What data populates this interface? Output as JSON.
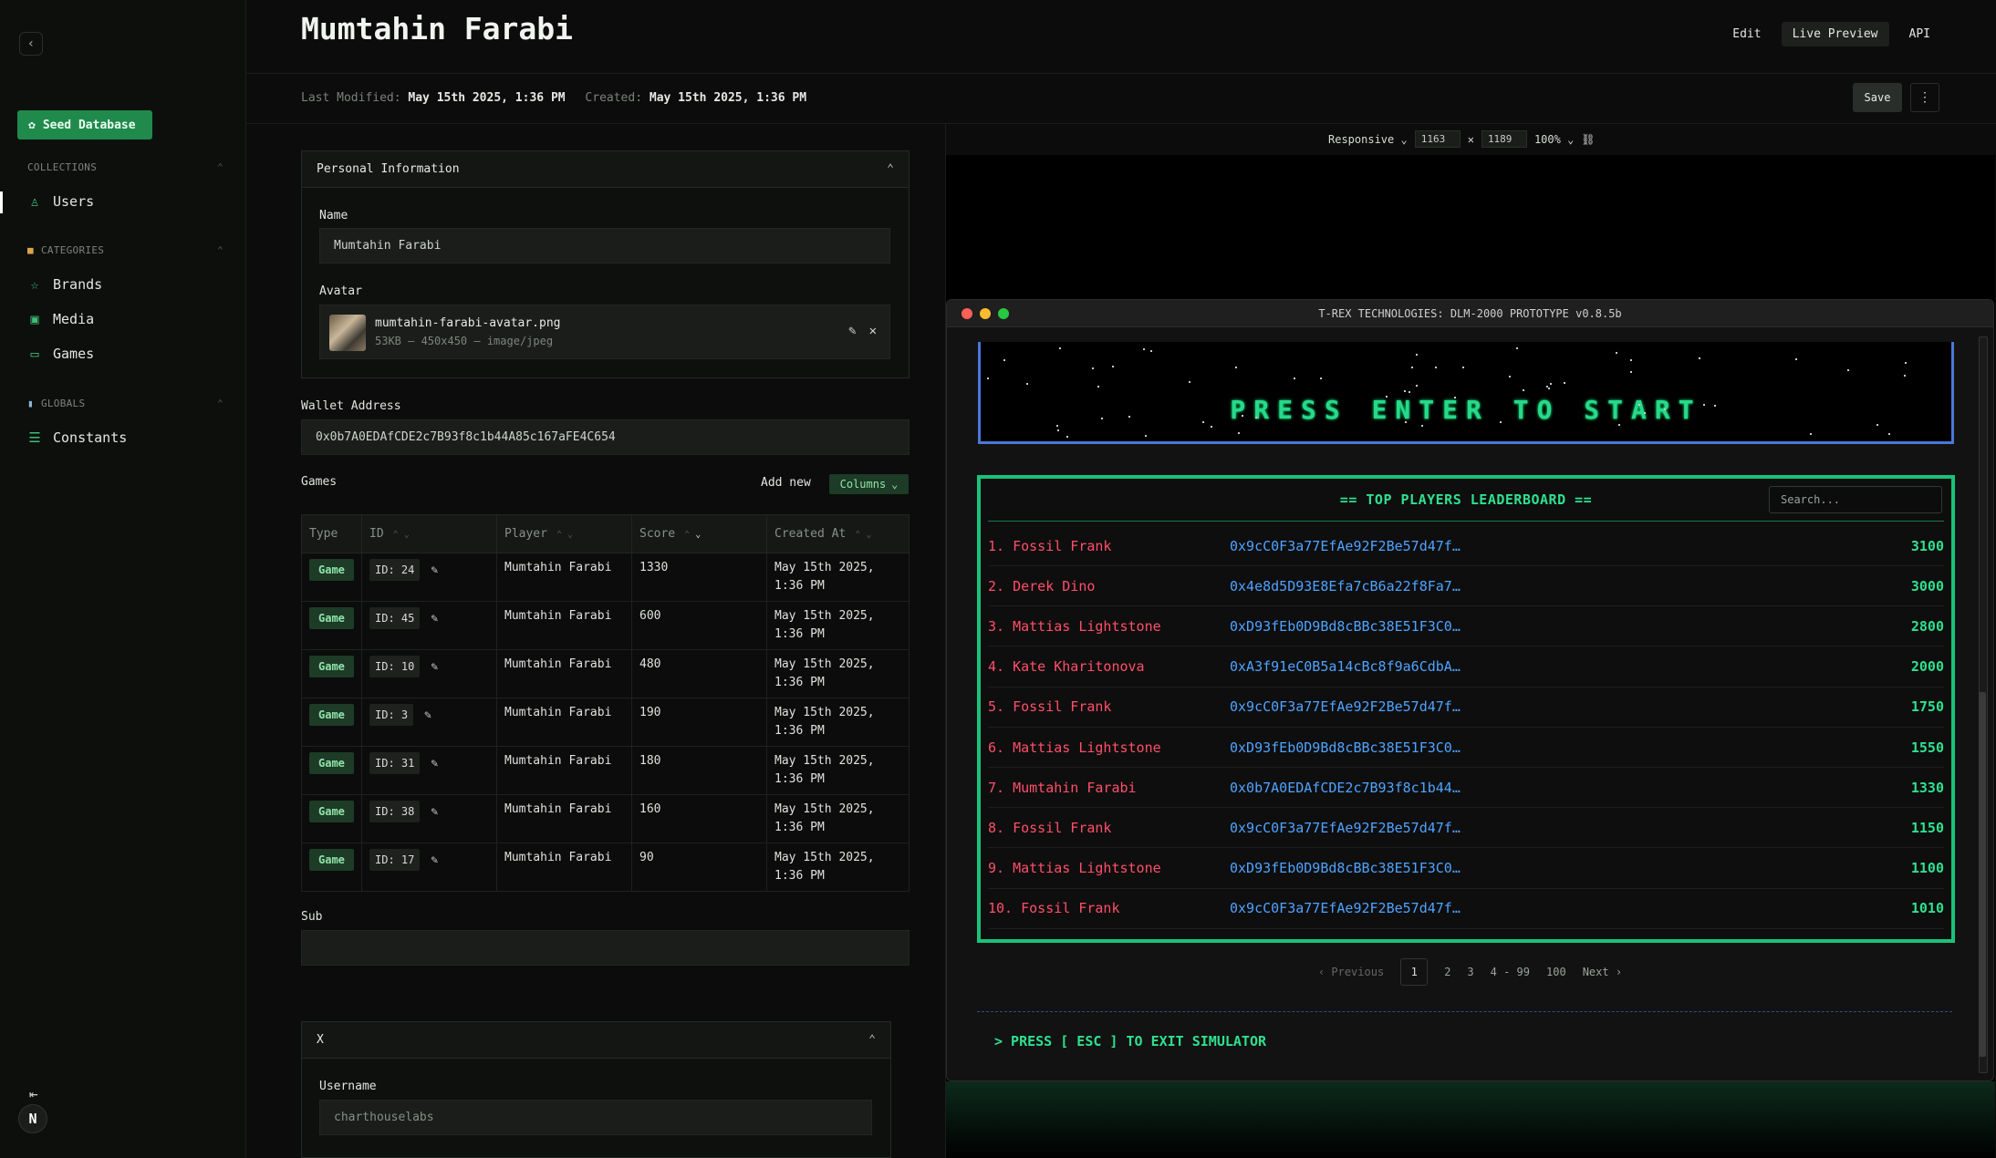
{
  "page": {
    "title": "Mumtahin Farabi"
  },
  "top_tabs": [
    "Edit",
    "Live Preview",
    "API"
  ],
  "meta": {
    "modified_label": "Last Modified:",
    "modified_value": "May 15th 2025, 1:36 PM",
    "created_label": "Created:",
    "created_value": "May 15th 2025, 1:36 PM"
  },
  "actions": {
    "save": "Save"
  },
  "sidebar": {
    "seed_button": "Seed Database",
    "collections_label": "COLLECTIONS",
    "users": "Users",
    "categories_label": "CATEGORIES",
    "brands": "Brands",
    "media": "Media",
    "games": "Games",
    "globals_label": "GLOBALS",
    "constants": "Constants",
    "avatar_letter": "N"
  },
  "form": {
    "personal_section": "Personal Information",
    "name_label": "Name",
    "name_value": "Mumtahin Farabi",
    "avatar_label": "Avatar",
    "avatar_file": "mumtahin-farabi-avatar.png",
    "avatar_meta": "53KB — 450x450 — image/jpeg",
    "wallet_label": "Wallet Address",
    "wallet_value": "0x0b7A0EDAfCDE2c7B93f8c1b44A85c167aFE4C654",
    "games_label": "Games",
    "add_new": "Add new",
    "columns": "Columns",
    "table_headers": {
      "type": "Type",
      "id": "ID",
      "player": "Player",
      "score": "Score",
      "created": "Created At"
    },
    "rows": [
      {
        "type": "Game",
        "id": "ID: 24",
        "player": "Mumtahin Farabi",
        "score": "1330",
        "date": "May 15th 2025,",
        "time": "1:36 PM"
      },
      {
        "type": "Game",
        "id": "ID: 45",
        "player": "Mumtahin Farabi",
        "score": "600",
        "date": "May 15th 2025,",
        "time": "1:36 PM"
      },
      {
        "type": "Game",
        "id": "ID: 10",
        "player": "Mumtahin Farabi",
        "score": "480",
        "date": "May 15th 2025,",
        "time": "1:36 PM"
      },
      {
        "type": "Game",
        "id": "ID: 3",
        "player": "Mumtahin Farabi",
        "score": "190",
        "date": "May 15th 2025,",
        "time": "1:36 PM"
      },
      {
        "type": "Game",
        "id": "ID: 31",
        "player": "Mumtahin Farabi",
        "score": "180",
        "date": "May 15th 2025,",
        "time": "1:36 PM"
      },
      {
        "type": "Game",
        "id": "ID: 38",
        "player": "Mumtahin Farabi",
        "score": "160",
        "date": "May 15th 2025,",
        "time": "1:36 PM"
      },
      {
        "type": "Game",
        "id": "ID: 17",
        "player": "Mumtahin Farabi",
        "score": "90",
        "date": "May 15th 2025,",
        "time": "1:36 PM"
      }
    ],
    "sub_label": "Sub",
    "x_section": "X",
    "username_label": "Username",
    "username_placeholder": "charthouselabs"
  },
  "preview": {
    "responsive": "Responsive",
    "width": "1163",
    "height": "1189",
    "zoom": "100%",
    "window_title": "T-REX TECHNOLOGIES: DLM-2000 PROTOTYPE v0.8.5b",
    "press_enter": "PRESS ENTER TO START",
    "board_title": "== TOP PLAYERS LEADERBOARD ==",
    "search_placeholder": "Search...",
    "leaderboard": [
      {
        "rank": "1.",
        "name": "Fossil Frank",
        "addr": "0x9cC0F3a77EfAe92F2Be57d47f…",
        "score": "3100"
      },
      {
        "rank": "2.",
        "name": "Derek Dino",
        "addr": "0x4e8d5D93E8Efa7cB6a22f8Fa7…",
        "score": "3000"
      },
      {
        "rank": "3.",
        "name": "Mattias Lightstone",
        "addr": "0xD93fEb0D9Bd8cBBc38E51F3C0…",
        "score": "2800"
      },
      {
        "rank": "4.",
        "name": "Kate Kharitonova",
        "addr": "0xA3f91eC0B5a14cBc8f9a6CdbA…",
        "score": "2000"
      },
      {
        "rank": "5.",
        "name": "Fossil Frank",
        "addr": "0x9cC0F3a77EfAe92F2Be57d47f…",
        "score": "1750"
      },
      {
        "rank": "6.",
        "name": "Mattias Lightstone",
        "addr": "0xD93fEb0D9Bd8cBBc38E51F3C0…",
        "score": "1550"
      },
      {
        "rank": "7.",
        "name": "Mumtahin Farabi",
        "addr": "0x0b7A0EDAfCDE2c7B93f8c1b44…",
        "score": "1330"
      },
      {
        "rank": "8.",
        "name": "Fossil Frank",
        "addr": "0x9cC0F3a77EfAe92F2Be57d47f…",
        "score": "1150"
      },
      {
        "rank": "9.",
        "name": "Mattias Lightstone",
        "addr": "0xD93fEb0D9Bd8cBBc38E51F3C0…",
        "score": "1100"
      },
      {
        "rank": "10.",
        "name": "Fossil Frank",
        "addr": "0x9cC0F3a77EfAe92F2Be57d47f…",
        "score": "1010"
      }
    ],
    "pager": {
      "prev": "‹ Previous",
      "pages": [
        "1",
        "2",
        "3",
        "4 - 99",
        "100"
      ],
      "next": "Next ›"
    },
    "esc_hint": "> PRESS [ ESC ] TO EXIT SIMULATOR"
  },
  "colors": {
    "accent": "#1f8a4c",
    "leader_name": "#ff4f6a",
    "leader_addr": "#4fa3ff",
    "leader_score": "#2fe08f"
  }
}
